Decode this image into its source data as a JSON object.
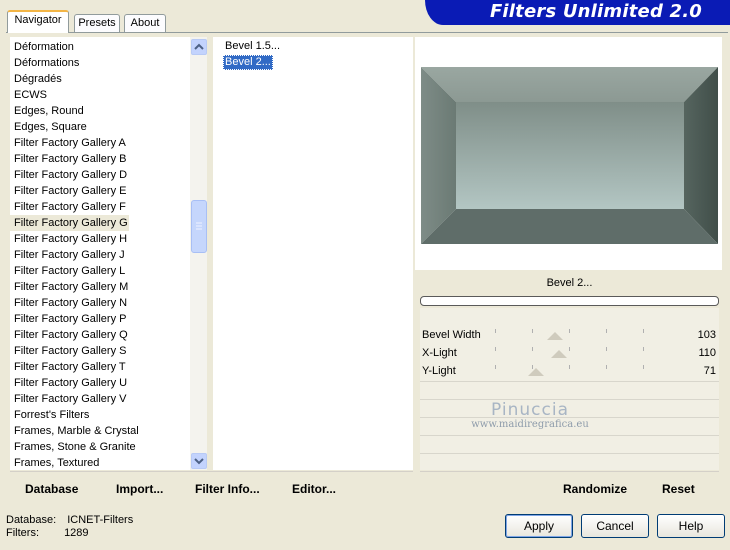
{
  "tabs": [
    "Navigator",
    "Presets",
    "About"
  ],
  "banner_title": "Filters Unlimited 2.0",
  "categories": [
    "Déformation",
    "Déformations",
    "Dégradés",
    "ECWS",
    "Edges, Round",
    "Edges, Square",
    "Filter Factory Gallery A",
    "Filter Factory Gallery B",
    "Filter Factory Gallery D",
    "Filter Factory Gallery E",
    "Filter Factory Gallery F",
    "Filter Factory Gallery G",
    "Filter Factory Gallery H",
    "Filter Factory Gallery J",
    "Filter Factory Gallery L",
    "Filter Factory Gallery M",
    "Filter Factory Gallery N",
    "Filter Factory Gallery P",
    "Filter Factory Gallery Q",
    "Filter Factory Gallery S",
    "Filter Factory Gallery T",
    "Filter Factory Gallery U",
    "Filter Factory Gallery V",
    "Forrest's Filters",
    "Frames, Marble & Crystal",
    "Frames, Stone & Granite",
    "Frames, Textured"
  ],
  "selected_category": "Filter Factory Gallery G",
  "filters": [
    "Bevel 1.5...",
    "Bevel 2..."
  ],
  "selected_filter": "Bevel 2...",
  "preview_label": "Bevel 2...",
  "params": [
    {
      "label": "Bevel Width",
      "value": "103",
      "level": 103
    },
    {
      "label": "X-Light",
      "value": "110",
      "level": 110
    },
    {
      "label": "Y-Light",
      "value": "71",
      "level": 71
    }
  ],
  "watermark": {
    "line1": "Pinuccia",
    "line2": "www.maidiregrafica.eu"
  },
  "left_buttons": {
    "database": "Database",
    "import": "Import...",
    "filter_info": "Filter Info...",
    "editor": "Editor..."
  },
  "right_buttons": {
    "randomize": "Randomize",
    "reset": "Reset"
  },
  "status": {
    "database_label": "Database:",
    "database_value": "ICNET-Filters",
    "filters_label": "Filters:",
    "filters_value": "1289"
  },
  "dialog_buttons": {
    "apply": "Apply",
    "cancel": "Cancel",
    "help": "Help"
  },
  "colors": {
    "banner": "#0a1bb5",
    "selection": "#316ac5",
    "dialog_bg": "#ece9d8"
  }
}
